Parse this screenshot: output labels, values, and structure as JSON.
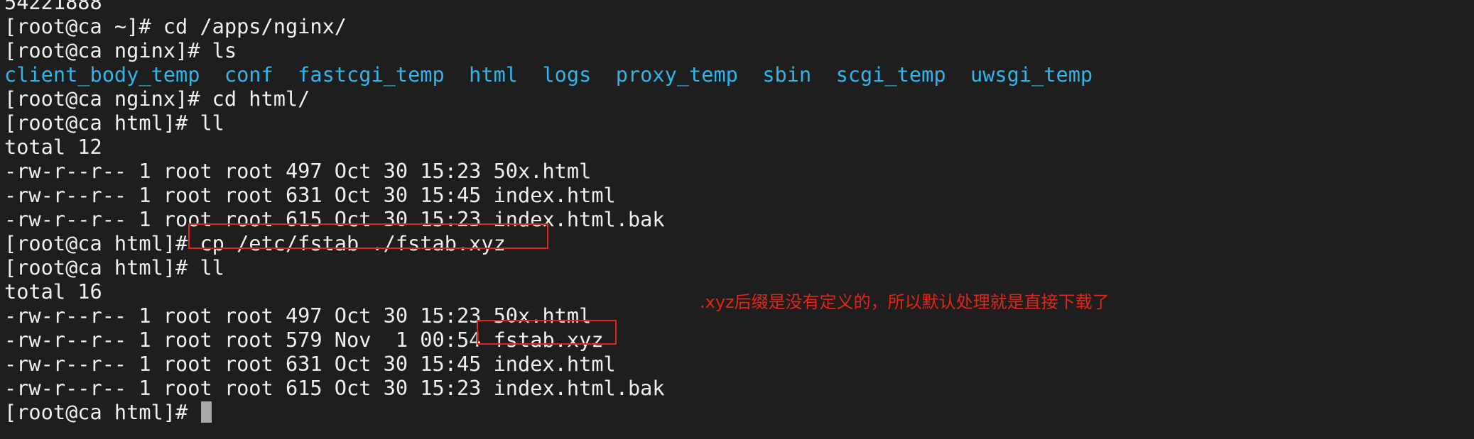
{
  "terminal": {
    "lines": [
      {
        "text": "54221888",
        "color": "text"
      },
      {
        "text": "[root@ca ~]# cd /apps/nginx/",
        "color": "text"
      },
      {
        "text": "[root@ca nginx]# ls",
        "color": "text"
      },
      {
        "text": "client_body_temp  conf  fastcgi_temp  html  logs  proxy_temp  sbin  scgi_temp  uwsgi_temp",
        "color": "dirs"
      },
      {
        "text": "[root@ca nginx]# cd html/",
        "color": "text"
      },
      {
        "text": "[root@ca html]# ll",
        "color": "text"
      },
      {
        "text": "total 12",
        "color": "text"
      },
      {
        "text": "-rw-r--r-- 1 root root 497 Oct 30 15:23 50x.html",
        "color": "text"
      },
      {
        "text": "-rw-r--r-- 1 root root 631 Oct 30 15:45 index.html",
        "color": "text"
      },
      {
        "text": "-rw-r--r-- 1 root root 615 Oct 30 15:23 index.html.bak",
        "color": "text"
      },
      {
        "text": "[root@ca html]# cp /etc/fstab ./fstab.xyz",
        "color": "text"
      },
      {
        "text": "[root@ca html]# ll",
        "color": "text"
      },
      {
        "text": "total 16",
        "color": "text"
      },
      {
        "text": "-rw-r--r-- 1 root root 497 Oct 30 15:23 50x.html",
        "color": "text"
      },
      {
        "text": "-rw-r--r-- 1 root root 579 Nov  1 00:54 fstab.xyz",
        "color": "text"
      },
      {
        "text": "-rw-r--r-- 1 root root 631 Oct 30 15:45 index.html",
        "color": "text"
      },
      {
        "text": "-rw-r--r-- 1 root root 615 Oct 30 15:23 index.html.bak",
        "color": "text"
      },
      {
        "text": "[root@ca html]# ",
        "color": "text",
        "cursor": true
      }
    ]
  },
  "annotation": {
    "text": ".xyz后缀是没有定义的，所以默认处理就是直接下载了"
  },
  "colors": {
    "background": "#1e1e1e",
    "text": "#f0f0f0",
    "directory": "#2fb5ea",
    "highlight": "#e0251b",
    "cursor": "#a9a9a9"
  }
}
